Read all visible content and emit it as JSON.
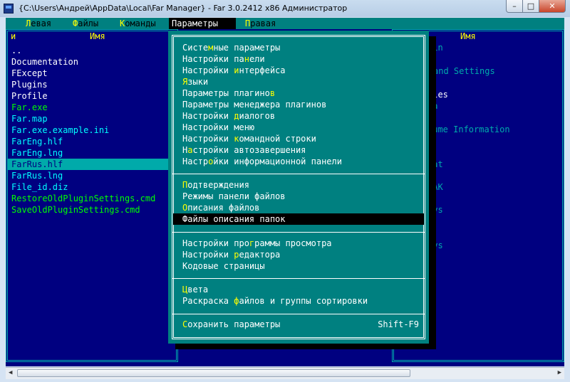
{
  "window": {
    "title": "{C:\\Users\\Андрей\\AppData\\Local\\Far Manager} - Far 3.0.2412 x86 Администратор",
    "controls": {
      "minimize": "–",
      "maximize": "□",
      "close": "✕"
    }
  },
  "menubar": {
    "items": [
      {
        "hot": "Л",
        "rest": "евая"
      },
      {
        "hot": "Ф",
        "rest": "айлы"
      },
      {
        "hot": "К",
        "rest": "оманды"
      },
      {
        "hot": "",
        "rest": "Параметры"
      },
      {
        "hot": "П",
        "rest": "равая"
      }
    ]
  },
  "left_panel": {
    "header_prefix": "и",
    "header_name": "Имя",
    "files": [
      {
        "name": ".."
      },
      {
        "name": "Documentation"
      },
      {
        "name": "FExcept"
      },
      {
        "name": "Plugins"
      },
      {
        "name": "Profile"
      },
      {
        "name": "Far.exe"
      },
      {
        "name": "Far.map"
      },
      {
        "name": "Far.exe.example.ini"
      },
      {
        "name": "FarEng.hlf"
      },
      {
        "name": "FarEng.lng"
      },
      {
        "name": "FarRus.hlf"
      },
      {
        "name": "FarRus.lng"
      },
      {
        "name": "File_id.diz"
      },
      {
        "name": "RestoreOldPluginSettings.cmd"
      },
      {
        "name": "SaveOldPluginSettings.cmd"
      }
    ]
  },
  "right_panel": {
    "header_name": "Имя",
    "visible_fragments": [
      "Bin",
      "and Settings",
      "iles",
      "ta",
      "lume Information",
      "bat",
      "BAK",
      "sys",
      "sys"
    ]
  },
  "dialog": {
    "groups": [
      [
        {
          "pre": "Систе",
          "hot": "м",
          "post": "ные параметры"
        },
        {
          "pre": "Настройки па",
          "hot": "н",
          "post": "ели"
        },
        {
          "pre": "Настройки ",
          "hot": "и",
          "post": "нтерфейса"
        },
        {
          "pre": "",
          "hot": "Я",
          "post": "зыки"
        },
        {
          "pre": "Параметры плагино",
          "hot": "в",
          "post": ""
        },
        {
          "pre": "Параметры менеджера плагинов",
          "hot": "",
          "post": ""
        },
        {
          "pre": "Настройки ",
          "hot": "д",
          "post": "иалогов"
        },
        {
          "pre": "Настройки меню",
          "hot": "",
          "post": ""
        },
        {
          "pre": "Настройки ",
          "hot": "к",
          "post": "омандной строки"
        },
        {
          "pre": "Н",
          "hot": "а",
          "post": "стройки автозавершения"
        },
        {
          "pre": "Настр",
          "hot": "о",
          "post": "йки информационной панели"
        }
      ],
      [
        {
          "pre": "",
          "hot": "П",
          "post": "одтверждения"
        },
        {
          "pre": "Режимы панели файлов",
          "hot": "",
          "post": ""
        },
        {
          "pre": "",
          "hot": "О",
          "post": "писания файлов"
        },
        {
          "pre": "Файлы описания папок",
          "hot": "",
          "post": ""
        }
      ],
      [
        {
          "pre": "Настройки про",
          "hot": "г",
          "post": "раммы просмотра"
        },
        {
          "pre": "Настройки ",
          "hot": "р",
          "post": "едактора"
        },
        {
          "pre": "Кодовые страницы",
          "hot": "",
          "post": ""
        }
      ],
      [
        {
          "pre": "",
          "hot": "Ц",
          "post": "вета"
        },
        {
          "pre": "Раскраска ",
          "hot": "ф",
          "post": "айлов и группы сортировки"
        }
      ],
      [
        {
          "pre": "",
          "hot": "С",
          "post": "охранить параметры"
        }
      ]
    ],
    "save_shortcut": "Shift-F9"
  },
  "colors": {
    "panel_bg": "#000080",
    "menu_bg": "#008080",
    "hotkey": "#ffff00",
    "selection": "#000000"
  }
}
